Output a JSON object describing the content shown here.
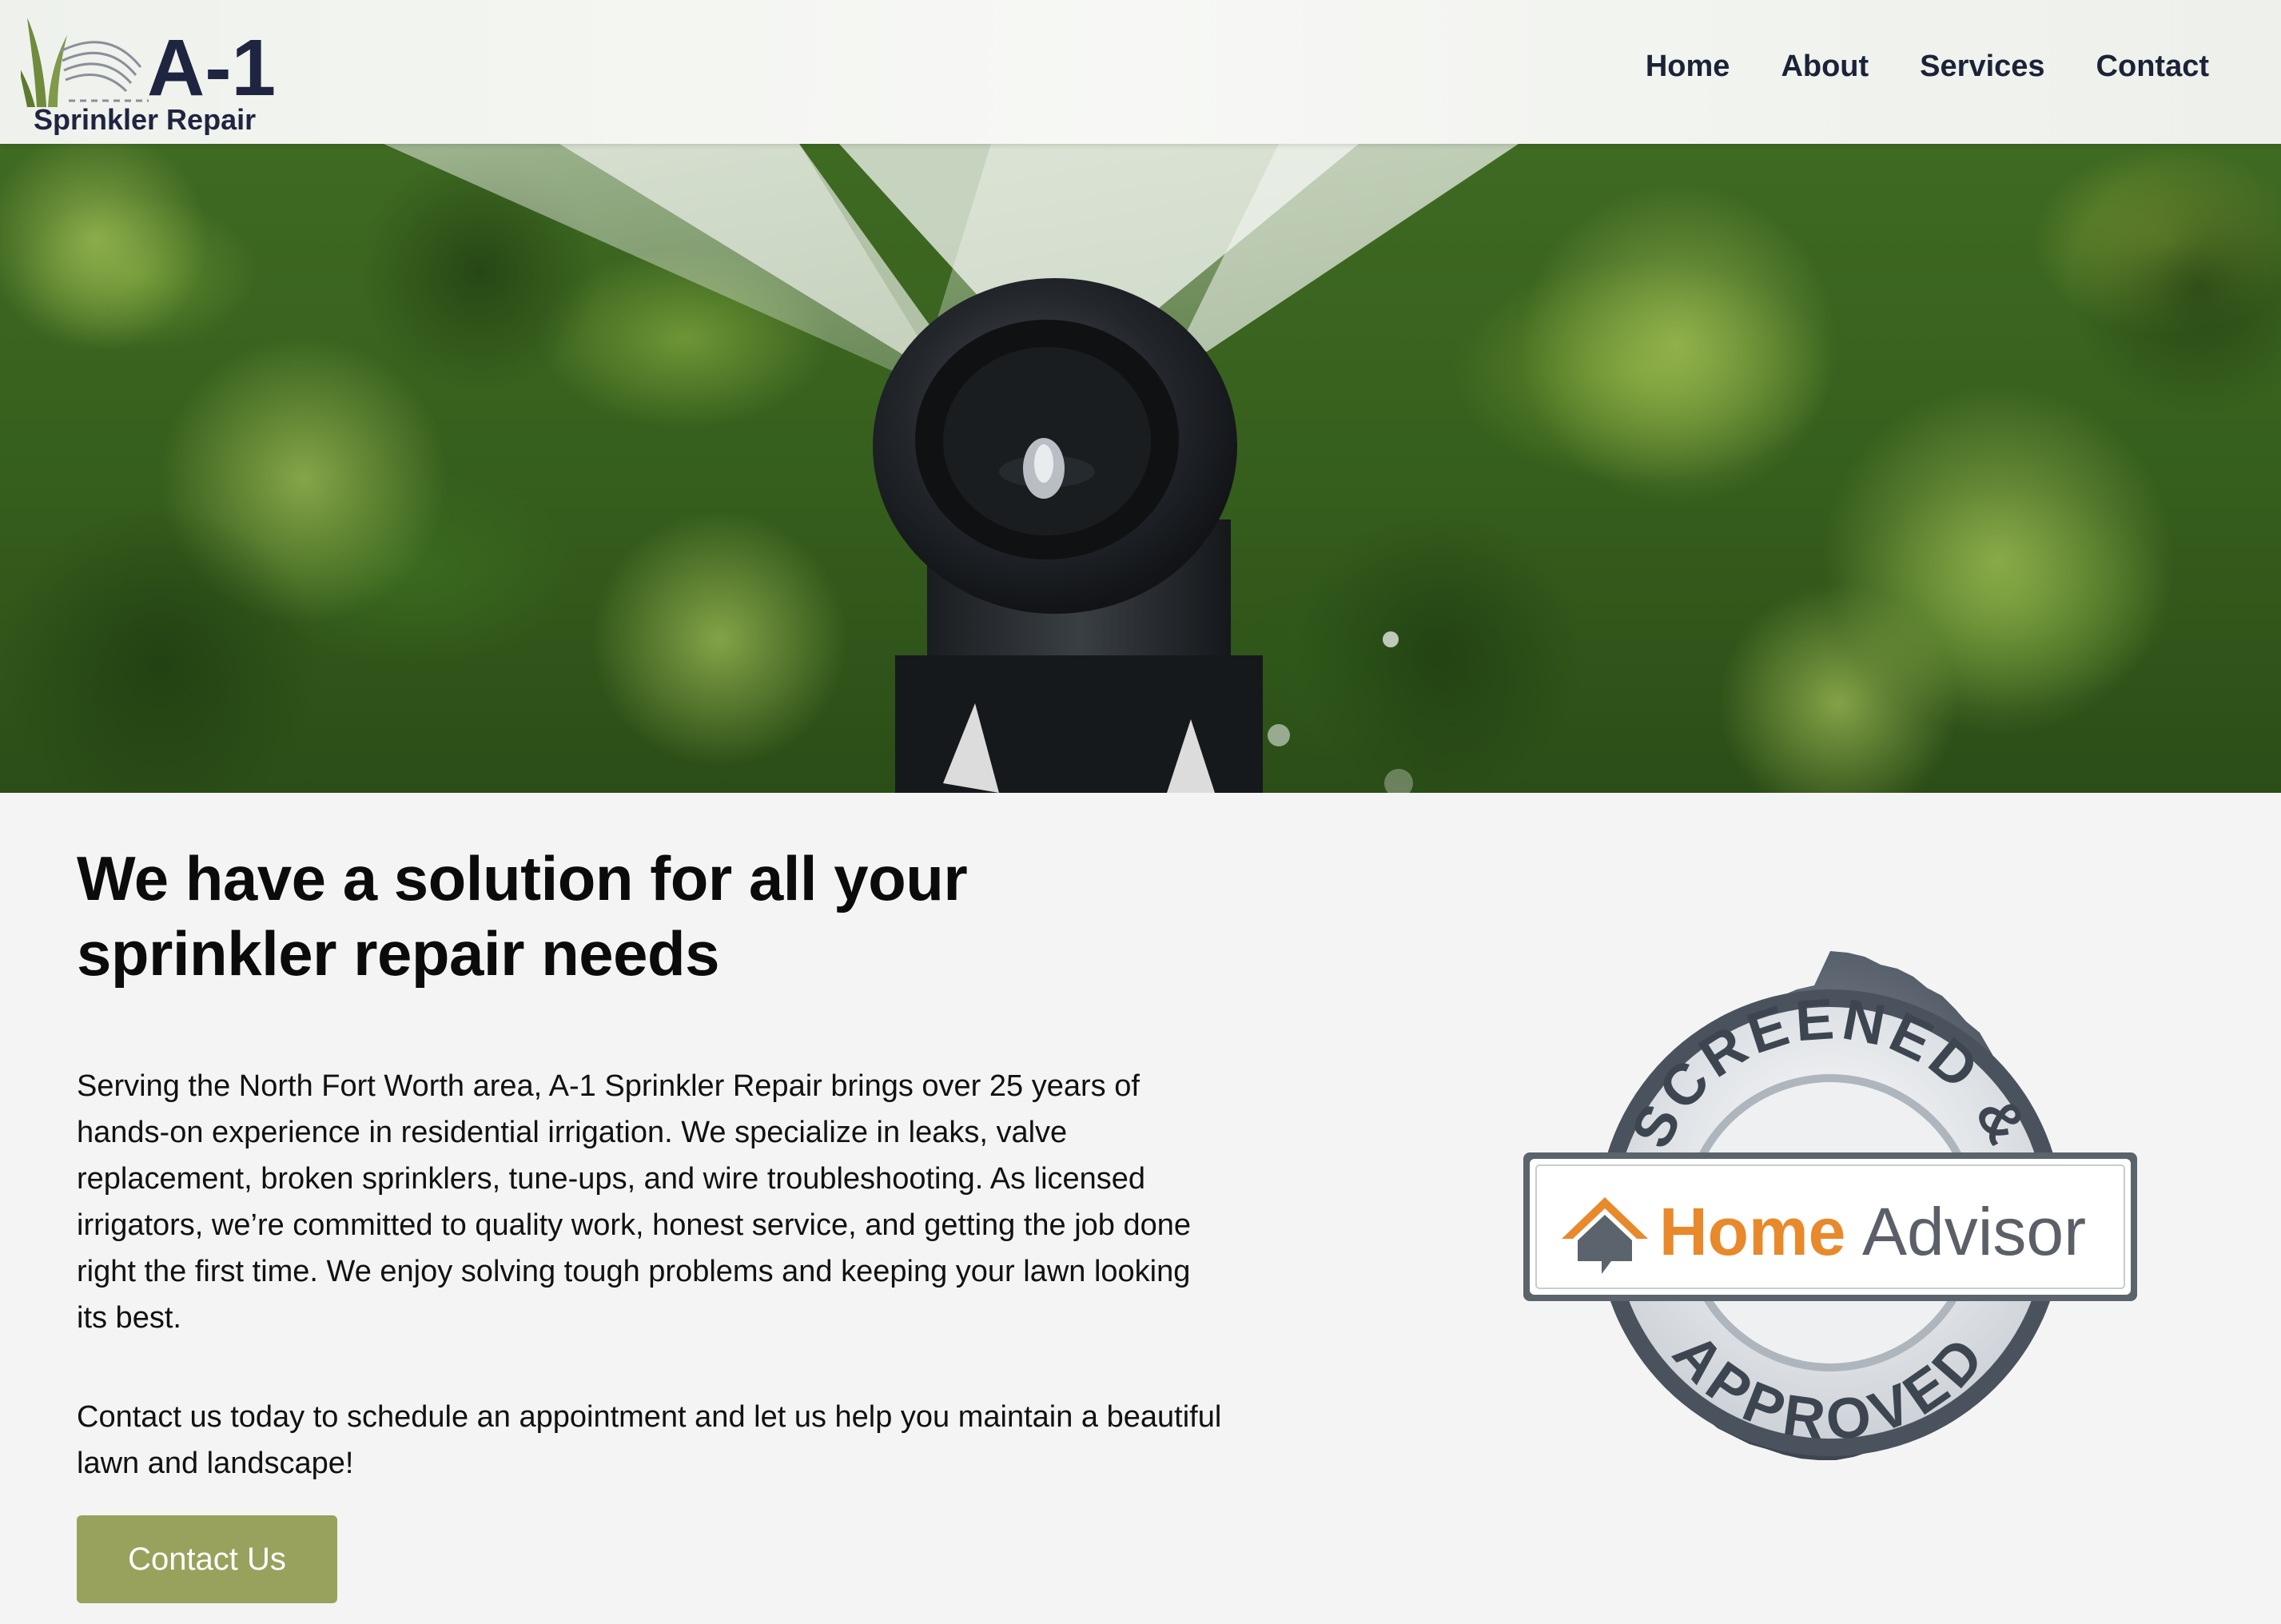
{
  "brand": {
    "logo_big": "A-1",
    "logo_small": "Sprinkler Repair"
  },
  "nav": {
    "items": [
      {
        "label": "Home"
      },
      {
        "label": "About"
      },
      {
        "label": "Services"
      },
      {
        "label": "Contact"
      }
    ]
  },
  "main": {
    "headline": "We have a solution for all your sprinkler repair needs",
    "paragraph1": "Serving the North Fort Worth area, A-1 Sprinkler Repair brings over 25 years of hands-on experience in residential irrigation. We specialize in leaks, valve replacement, broken sprinklers, tune-ups, and wire troubleshooting. As licensed irrigators, we’re committed to quality work, honest service, and getting the job done right the first time. We enjoy solving tough problems and keeping your lawn looking its best.",
    "paragraph2": "Contact us today to schedule an appointment and let us help you maintain a beautiful lawn and landscape!",
    "cta_label": "Contact Us"
  },
  "badge": {
    "top_text": "SCREENED &",
    "bottom_text": "APPROVED",
    "brand_home": "Home",
    "brand_advisor": "Advisor"
  },
  "colors": {
    "nav_text": "#1c2237",
    "cta_bg": "#98a25c",
    "home_orange": "#e8892b",
    "advisor_gray": "#5b6068"
  }
}
